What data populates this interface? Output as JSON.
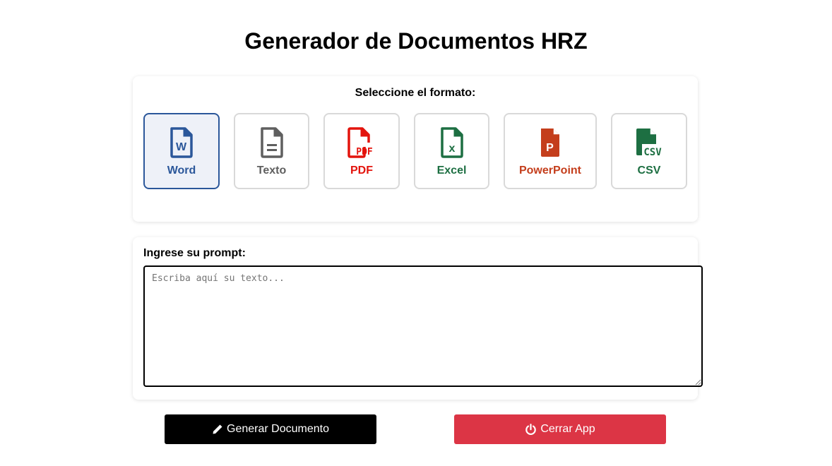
{
  "title": "Generador de Documentos HRZ",
  "format_section": {
    "heading": "Seleccione el formato:",
    "selected": "Word",
    "options": [
      {
        "label": "Word",
        "icon": "word-file-icon",
        "color": "#2b579a",
        "selected": true
      },
      {
        "label": "Texto",
        "icon": "text-file-icon",
        "color": "#5f5f5f",
        "selected": false
      },
      {
        "label": "PDF",
        "icon": "pdf-file-icon",
        "color": "#e3140d",
        "selected": false
      },
      {
        "label": "Excel",
        "icon": "excel-file-icon",
        "color": "#1d6f42",
        "selected": false
      },
      {
        "label": "PowerPoint",
        "icon": "powerpoint-file-icon",
        "color": "#c43e1c",
        "selected": false
      },
      {
        "label": "CSV",
        "icon": "csv-file-icon",
        "color": "#1d6f42",
        "selected": false
      }
    ]
  },
  "prompt_section": {
    "label": "Ingrese su prompt:",
    "value": "",
    "placeholder": "Escriba aquí su texto..."
  },
  "buttons": {
    "generate": {
      "label": "Generar Documento",
      "icon": "pencil-icon",
      "color": "#000000"
    },
    "close": {
      "label": "Cerrar App",
      "icon": "power-icon",
      "color": "#dc3545"
    }
  }
}
